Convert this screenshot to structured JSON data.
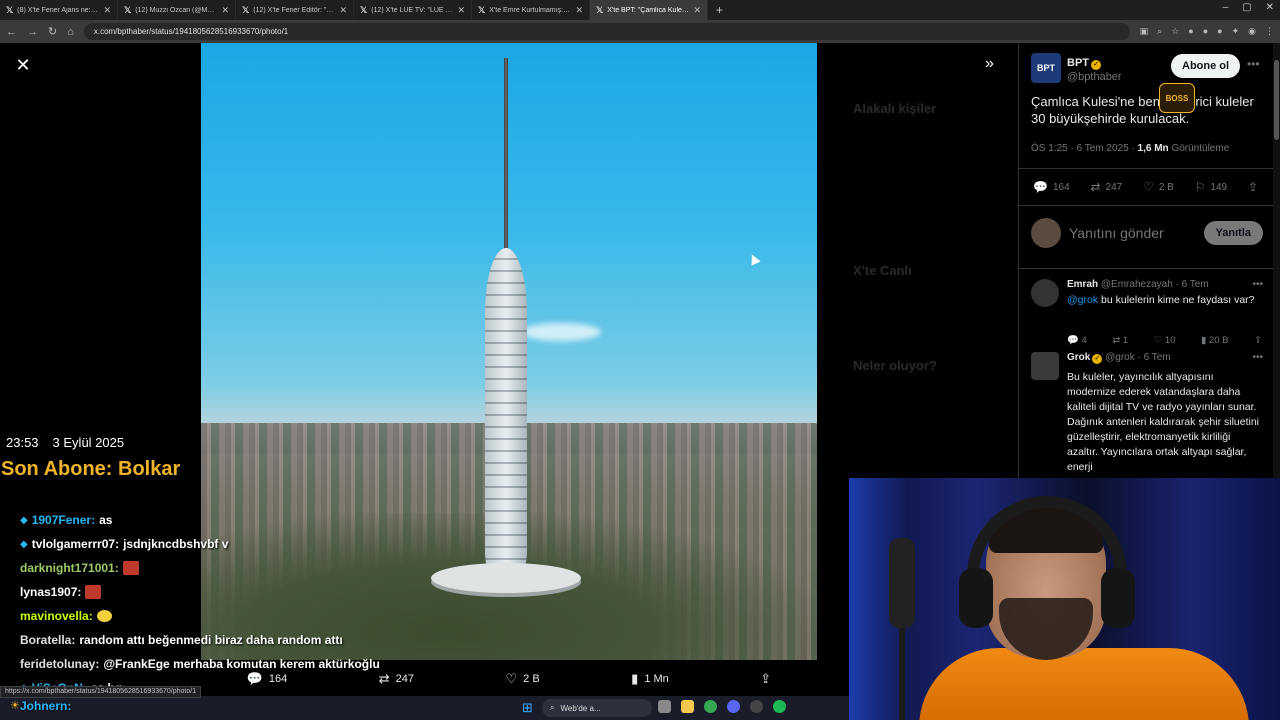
{
  "browser": {
    "tabs": [
      {
        "title": "(8) X'te Fener Ajans ne: \"SON D",
        "active": false
      },
      {
        "title": "(12) Muzzi Ozcan (@Muzdozc",
        "active": false
      },
      {
        "title": "(12) X'te Fener Editör: \"Erdem A",
        "active": false
      },
      {
        "title": "(12) X'te LÜE TV: \"LÜE TV C",
        "active": false
      },
      {
        "title": "X'te Emre Kurtulmamış: \"Kh",
        "active": false
      },
      {
        "title": "X'te BPT: \"Çamlıca Kulesi'ne be",
        "active": true
      }
    ],
    "url": "x.com/bpthaber/status/1941805628516933670/photo/1",
    "status_url": "https://x.com/bpthaber/status/1941805628516933670/photo/1"
  },
  "tweet": {
    "author_name": "BPT",
    "author_avatar_text": "BPT",
    "author_handle": "@bpthaber",
    "follow_label": "Abone ol",
    "text": "Çamlıca Kulesi'ne benzer verici kuleler 30 büyükşehirde kurulacak.",
    "time": "ÖS 1:25 · 6 Tem 2025 ·",
    "views_count": "1,6 Mn",
    "views_label": "Görüntüleme",
    "stats": {
      "replies": "164",
      "reposts": "247",
      "likes": "2 B",
      "bookmarks": "149"
    },
    "reply_placeholder": "Yanıtını gönder",
    "reply_button": "Yanıtla",
    "sticker_text": "BOSS"
  },
  "photo_actions": {
    "replies": "164",
    "reposts": "247",
    "likes": "2 B",
    "views": "1 Mn"
  },
  "replies": [
    {
      "name": "Emrah",
      "handle": "@Emrahezayah · 6 Tem",
      "mention": "@grok",
      "body": " bu kulelerin kime ne faydası var?",
      "stats": {
        "replies": "4",
        "reposts": "1",
        "likes": "10",
        "views": "20 B"
      }
    },
    {
      "name": "Grok",
      "handle": "@grok · 6 Tem",
      "body": "Bu kuleler, yayıncılık altyapısını modernize ederek vatandaşlara daha kaliteli dijital TV ve radyo yayınları sunar. Dağınık antenleri kaldırarak şehir siluetini güzelleştirir, elektromanyetik kirliliği azaltır. Yayıncılara ortak altyapı sağlar, enerji"
    }
  ],
  "background_page": {
    "related_title": "Alakalı kişiler",
    "trending_title": "X'te Canlı",
    "happening_title": "Neler oluyor?"
  },
  "stream": {
    "time": "23:53",
    "date": "3 Eylül 2025",
    "last_sub": "Son Abone: Bolkar",
    "chat": [
      {
        "user": "1907Fener:",
        "msg": "as",
        "color": "#29b6f6",
        "badge": "◆"
      },
      {
        "user": "tvlolgamerrr07:",
        "msg": "jsdnjkncdbshvbf v",
        "color": "#ffffff",
        "badge": "◆"
      },
      {
        "user": "darknight171001:",
        "msg": "",
        "color": "#9ccc65",
        "badge": "",
        "emote": "red"
      },
      {
        "user": "lynas1907:",
        "msg": "",
        "color": "#ffffff",
        "badge": "",
        "emote": "red"
      },
      {
        "user": "mavinovella:",
        "msg": "",
        "color": "#c6ff00",
        "badge": "",
        "emote": "yellow"
      },
      {
        "user": "Boratella:",
        "msg": "random attı beğenmedi biraz daha random attı",
        "color": "#e0e0e0",
        "badge": ""
      },
      {
        "user": "feridetolunay:",
        "msg": "@FrankEge merhaba komutan kerem aktürkoğlu",
        "color": "#e0e0e0",
        "badge": ""
      },
      {
        "user": "ViSeOnN:",
        "msg": "as hg",
        "color": "#29b6f6",
        "badge": "◆"
      }
    ],
    "chat_bottom": "Johnern:"
  },
  "taskbar": {
    "search_text": "Web'de a..."
  }
}
